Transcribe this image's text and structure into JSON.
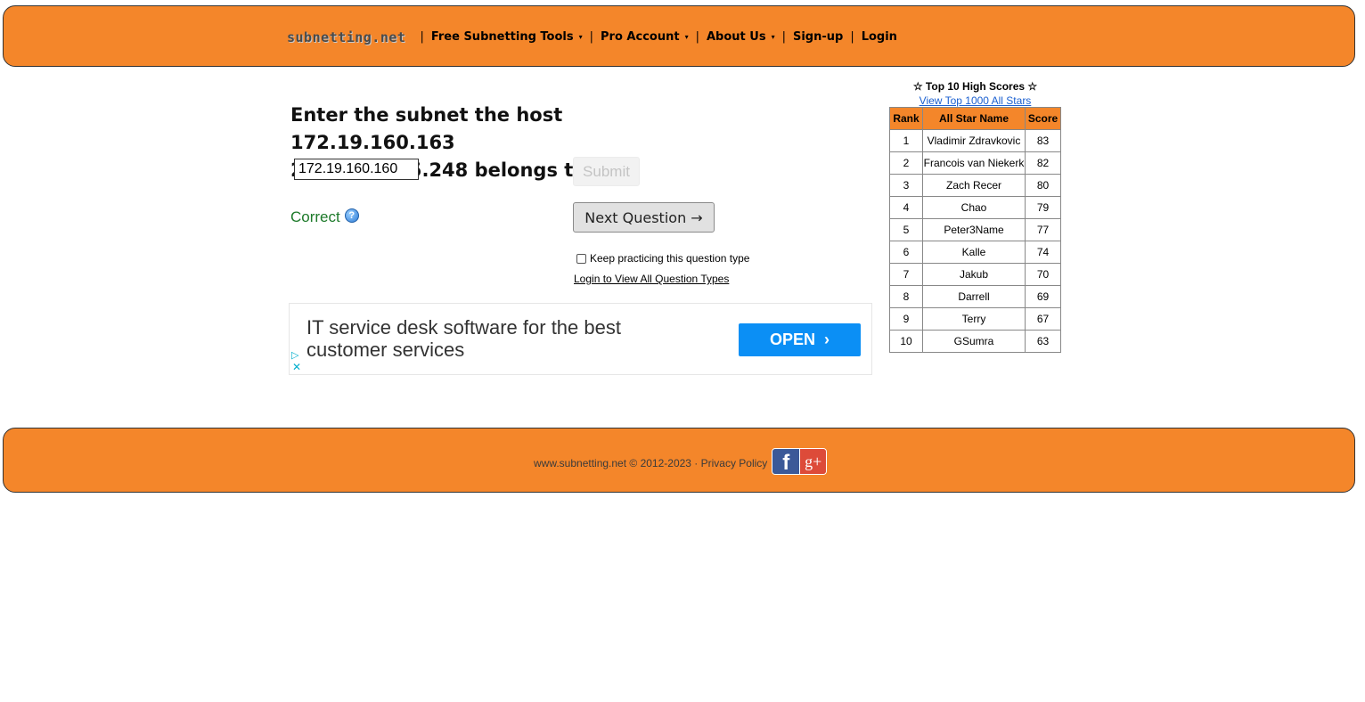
{
  "header": {
    "logo": "subnetting.net",
    "separator": "|",
    "nav": [
      {
        "label": "Free Subnetting Tools",
        "has_dropdown": true
      },
      {
        "label": "Pro Account",
        "has_dropdown": true
      },
      {
        "label": "About Us",
        "has_dropdown": true
      },
      {
        "label": "Sign-up",
        "has_dropdown": false
      },
      {
        "label": "Login",
        "has_dropdown": false
      }
    ],
    "caret": "▾",
    "background_color": "#f4862a"
  },
  "question": {
    "line1": "Enter the subnet the host 172.19.160.163",
    "line2": "255.255.255.248 belongs to:",
    "answer_value": "172.19.160.160",
    "submit_label": "Submit",
    "result_text": "Correct",
    "help_icon": "question-mark-icon",
    "next_label": "Next Question →",
    "keep_practicing_label": "Keep practicing this question type",
    "keep_practicing_checked": false,
    "login_link": "Login to View All Question Types"
  },
  "ad": {
    "text": "IT service desk software for the best customer services",
    "button_label": "OPEN",
    "chevron": "›",
    "play_icon": "▷",
    "close_icon": "✕",
    "button_color": "#0b8ff5"
  },
  "high_scores": {
    "title": "☆ Top 10 High Scores ☆",
    "link": "View Top 1000 All Stars",
    "columns": [
      "Rank",
      "All Star Name",
      "Score"
    ],
    "rows": [
      {
        "rank": "1",
        "name": "Vladimir Zdravkovic",
        "score": "83"
      },
      {
        "rank": "2",
        "name": "Francois van Niekerk",
        "score": "82"
      },
      {
        "rank": "3",
        "name": "Zach Recer",
        "score": "80"
      },
      {
        "rank": "4",
        "name": "Chao",
        "score": "79"
      },
      {
        "rank": "5",
        "name": "Peter3Name",
        "score": "77"
      },
      {
        "rank": "6",
        "name": "Kalle",
        "score": "74"
      },
      {
        "rank": "7",
        "name": "Jakub",
        "score": "70"
      },
      {
        "rank": "8",
        "name": "Darrell",
        "score": "69"
      },
      {
        "rank": "9",
        "name": "Terry",
        "score": "67"
      },
      {
        "rank": "10",
        "name": "GSumra",
        "score": "63"
      }
    ]
  },
  "footer": {
    "copyright": "www.subnetting.net © 2012-2023 · ",
    "privacy": "Privacy Policy",
    "facebook_glyph": "f",
    "googleplus_glyph": "g+"
  }
}
